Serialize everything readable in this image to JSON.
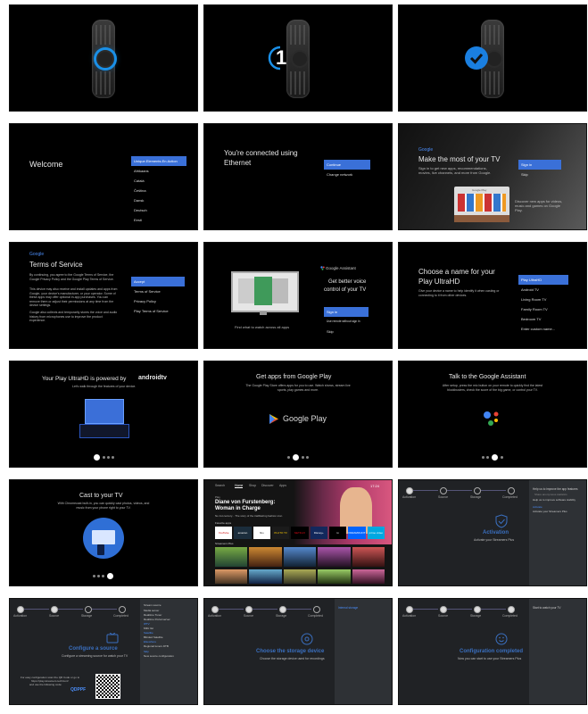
{
  "row1": {
    "countdown": "1"
  },
  "welcome": {
    "title": "Welcome",
    "menu": [
      "Unique.Elements.En.Action",
      "Afrikaans",
      "Català",
      "Čeština",
      "Dansk",
      "Deutsch",
      "Eesti"
    ]
  },
  "ethernet": {
    "title_line1": "You're connected using",
    "title_line2": "Ethernet",
    "menu": [
      "Continue",
      "Change network"
    ]
  },
  "most": {
    "brand": "Google",
    "title": "Make the most of your TV",
    "desc": "Sign in to get new apps, recommendations, movies, live channels, and more from Google.",
    "play_label": "Google Play",
    "menu": [
      "Sign in",
      "Skip"
    ],
    "side_note": "Discover new apps for videos, music and games on Google Play."
  },
  "tos": {
    "brand": "Google",
    "title": "Terms of Service",
    "para1": "By continuing, you agree to the Google Terms of Service, the Google Privacy Policy and the Google Play Terms of Service.",
    "para2": "This device may also receive and install updates and apps from Google, your device's manufacturer, or your operator. Some of these apps may offer optional in-app purchases. You can remove them or adjust their permissions at any time from the device settings.",
    "para3": "Google also collects and temporarily stores the voice and audio history from microphones use to improve the product experience.",
    "menu": [
      "Accept",
      "Terms of Service",
      "Privacy Policy",
      "Play Terms of Service"
    ]
  },
  "assistant": {
    "brand": "Google Assistant",
    "title_line1": "Get better voice",
    "title_line2": "control of your TV",
    "caption": "Find what to watch across all apps",
    "menu": [
      "Sign in",
      "Use remote without sign in",
      "Skip"
    ]
  },
  "name": {
    "title_line1": "Choose a name for your",
    "title_line2": "Play UltraHD",
    "desc": "Give your device a name to help identify it when casting or connecting to it from other devices.",
    "menu": [
      "Play UltraHD",
      "Android TV",
      "Living Room TV",
      "Family Room TV",
      "Bedroom TV",
      "Enter custom name..."
    ]
  },
  "powered": {
    "title": "Your Play UltraHD is powered by",
    "brand": "androidtv",
    "sub": "Let's walk through the features of your device."
  },
  "getapps": {
    "title": "Get apps from Google Play",
    "sub": "The Google Play Store offers apps for you to use. Watch shows, stream live sports, play games and more.",
    "logo": "Google Play"
  },
  "talk": {
    "title": "Talk to the Google Assistant",
    "sub": "After setup, press the mic button on your remote to quickly find the latest blockbusters, check the score of the big game, or control your TV."
  },
  "cast": {
    "title": "Cast to your TV",
    "sub": "With Chromecast built-in, you can quickly cast photos, videos, and music from your phone right to your TV."
  },
  "home": {
    "tabs": [
      "Search",
      "Home",
      "Shop",
      "Discover",
      "Apps"
    ],
    "time": "17:24",
    "kicker": "Play",
    "headline_line1": "Diane von Furstenberg:",
    "headline_line2": "Woman in Charge",
    "tagline": "No 1st century... The story of the trailblazing fashion icon",
    "row_title": "Favorite apps",
    "apps": [
      "YouTube",
      "amazon",
      "hbo",
      "PLUTO TV",
      "NETFLIX",
      "Disney+",
      "tv",
      "PARAMOUNT",
      "prime video"
    ],
    "label": "Streamers Plus"
  },
  "activation": {
    "steps": [
      "Activation",
      "Source",
      "Storage",
      "Completed"
    ],
    "title": "Activation",
    "sub": "Activate your Streamers Plus",
    "panel": [
      "Help us to improve the app features",
      "Share anonymous statistics",
      "Help us to improve software stability",
      "Activate",
      "Activate your Streamers Plus"
    ]
  },
  "configure": {
    "steps": [
      "Activation",
      "Source",
      "Storage",
      "Completed"
    ],
    "title": "Configure a source",
    "sub": "Configure a streaming source for watch your TV",
    "qr_text_1": "For easy configuration scan the QR Code or go to",
    "qr_text_2": "https://play.streamers.tech/conf",
    "qr_text_3": "and use the following code:",
    "code": "QDPPF",
    "panel": [
      "Stream source",
      "Media server",
      "Realtime Tuner",
      "Realtime Portal server",
      "IPTV",
      "M3U list",
      "Satellite",
      "Blinded Satellite",
      "Elsewhere",
      "Regional tuners DTB",
      "Skip",
      "New source configuration"
    ]
  },
  "storage": {
    "steps": [
      "Activation",
      "Source",
      "Storage",
      "Completed"
    ],
    "title": "Choose the storage device",
    "sub": "Choose the storage device used for recordings",
    "panel": [
      "Internal storage"
    ]
  },
  "completed": {
    "steps": [
      "Activation",
      "Source",
      "Storage",
      "Completed"
    ],
    "title": "Configuration completed",
    "sub": "Now you can start to use your Streamers Plus",
    "panel": [
      "Start to watch your TV"
    ]
  },
  "colors": {
    "accent": "#3b73db",
    "check": "#1a7fe0",
    "ring": "#1a90e8",
    "config_title": "#3a6fbf"
  }
}
